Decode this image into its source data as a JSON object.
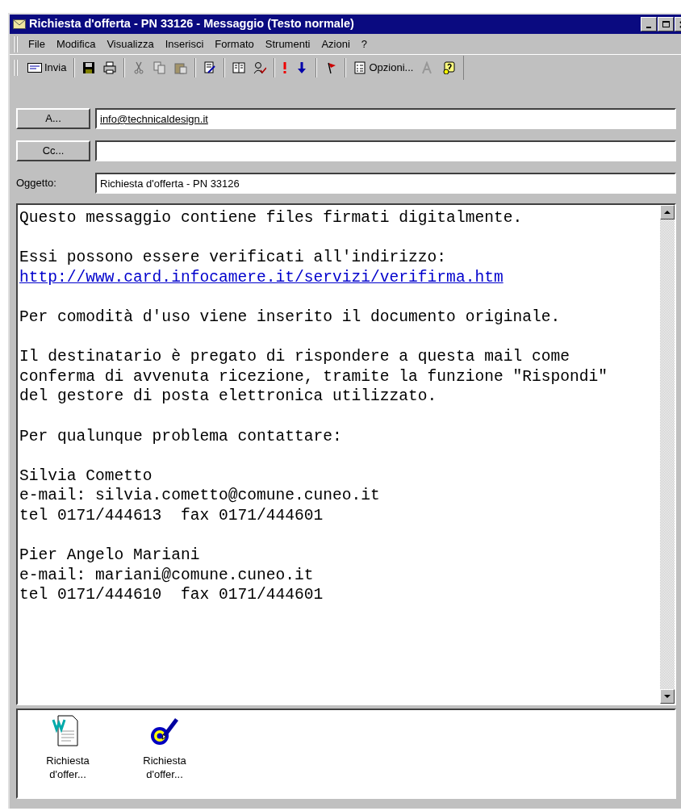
{
  "window": {
    "title": "Richiesta d'offerta  - PN 33126 - Messaggio (Testo normale)"
  },
  "menu": [
    "File",
    "Modifica",
    "Visualizza",
    "Inserisci",
    "Formato",
    "Strumenti",
    "Azioni",
    "?"
  ],
  "toolbar": [
    {
      "kind": "text-button",
      "label": "Invia",
      "disabled": false
    },
    {
      "kind": "separator"
    },
    {
      "kind": "icon",
      "disabled": false
    },
    {
      "kind": "icon",
      "disabled": false
    },
    {
      "kind": "separator"
    },
    {
      "kind": "icon",
      "disabled": true
    },
    {
      "kind": "icon",
      "disabled": true
    },
    {
      "kind": "icon",
      "disabled": true
    },
    {
      "kind": "separator"
    },
    {
      "kind": "icon",
      "disabled": false
    },
    {
      "kind": "separator"
    },
    {
      "kind": "icon",
      "disabled": false
    },
    {
      "kind": "icon",
      "disabled": false
    },
    {
      "kind": "separator"
    },
    {
      "kind": "icon",
      "disabled": false
    },
    {
      "kind": "icon",
      "disabled": false
    },
    {
      "kind": "separator"
    },
    {
      "kind": "icon",
      "disabled": false
    },
    {
      "kind": "separator"
    },
    {
      "kind": "text-button",
      "label": "Opzioni...",
      "disabled": false
    },
    {
      "kind": "icon",
      "disabled": true
    },
    {
      "kind": "icon",
      "disabled": false
    }
  ],
  "fields": [
    {
      "kind": "button",
      "label": "A...",
      "value": "info@technicaldesign.it"
    },
    {
      "kind": "button",
      "label": "Cc..."
    },
    {
      "kind": "label",
      "label": "Oggetto:",
      "value": "Richiesta d'offerta  - PN 33126"
    }
  ],
  "body": {
    "paragraphs": [
      {
        "lines": [
          {
            "kind": "text",
            "text": "Questo messaggio contiene files firmati digitalmente."
          }
        ]
      },
      {
        "lines": [
          {
            "kind": "text",
            "text": "Essi possono essere verificati all'indirizzo:"
          },
          {
            "kind": "link",
            "text": "http://www.card.infocamere.it/servizi/verifirma.htm"
          }
        ]
      },
      {
        "lines": [
          {
            "kind": "text",
            "text": "Per comodità d'uso viene inserito il documento originale."
          }
        ]
      },
      {
        "lines": [
          {
            "kind": "text",
            "text": "Il destinatario è pregato di rispondere a questa mail come"
          },
          {
            "kind": "text",
            "text": "conferma di avvenuta ricezione, tramite la funzione \"Rispondi\""
          },
          {
            "kind": "text",
            "text": "del gestore di posta elettronica utilizzato."
          }
        ]
      },
      {
        "lines": [
          {
            "kind": "text",
            "text": "Per qualunque problema contattare:"
          }
        ]
      },
      {
        "lines": [
          {
            "kind": "text",
            "text": "Silvia Cometto"
          },
          {
            "kind": "text",
            "text": "e-mail: silvia.cometto@comune.cuneo.it"
          },
          {
            "kind": "text",
            "text": "tel 0171/444613  fax 0171/444601"
          }
        ]
      },
      {
        "lines": [
          {
            "kind": "text",
            "text": "Pier Angelo Mariani"
          },
          {
            "kind": "text",
            "text": "e-mail: mariani@comune.cuneo.it"
          },
          {
            "kind": "text",
            "text": "tel 0171/444610  fax 0171/444601"
          }
        ]
      }
    ]
  },
  "attachments": [
    {
      "kind": "word",
      "name": "Richiesta d'offer..."
    },
    {
      "kind": "signed",
      "name": "Richiesta d'offer..."
    }
  ]
}
